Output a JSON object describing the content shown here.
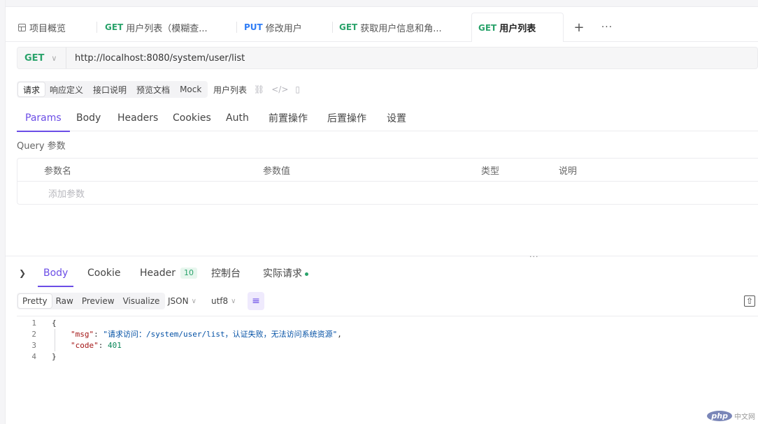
{
  "tabs": [
    {
      "method": "",
      "label": "项目概览",
      "icon": "overview-icon"
    },
    {
      "method": "GET",
      "label": "用户列表（模糊查..."
    },
    {
      "method": "PUT",
      "label": "修改用户"
    },
    {
      "method": "GET",
      "label": "获取用户信息和角..."
    },
    {
      "method": "GET",
      "label": "用户列表",
      "active": true
    }
  ],
  "request": {
    "method": "GET",
    "url": "http://localhost:8080/system/user/list"
  },
  "subtabs": [
    "请求",
    "响应定义",
    "接口说明",
    "预览文档",
    "Mock"
  ],
  "api_name": "用户列表",
  "param_tabs": [
    "Params",
    "Body",
    "Headers",
    "Cookies",
    "Auth",
    "前置操作",
    "后置操作",
    "设置"
  ],
  "query_label": "Query 参数",
  "param_table": {
    "headers": [
      "参数名",
      "参数值",
      "类型",
      "说明"
    ],
    "add_placeholder": "添加参数"
  },
  "response": {
    "tabs": [
      "Body",
      "Cookie",
      "Header",
      "控制台",
      "实际请求"
    ],
    "header_count": "10",
    "view_modes": [
      "Pretty",
      "Raw",
      "Preview",
      "Visualize"
    ],
    "format": "JSON",
    "encoding": "utf8",
    "lines": [
      "1",
      "2",
      "3",
      "4"
    ],
    "body": {
      "open": "{",
      "msg_key": "\"msg\"",
      "msg_value": "\"请求访问：/system/user/list，认证失败，无法访问系统资源\"",
      "code_key": "\"code\"",
      "code_value": "401",
      "close": "}"
    }
  },
  "watermark": {
    "logo": "php",
    "text": "中文网"
  },
  "colors": {
    "accent": "#6b4de6",
    "get": "#2aa36b",
    "put": "#2f7df6"
  }
}
